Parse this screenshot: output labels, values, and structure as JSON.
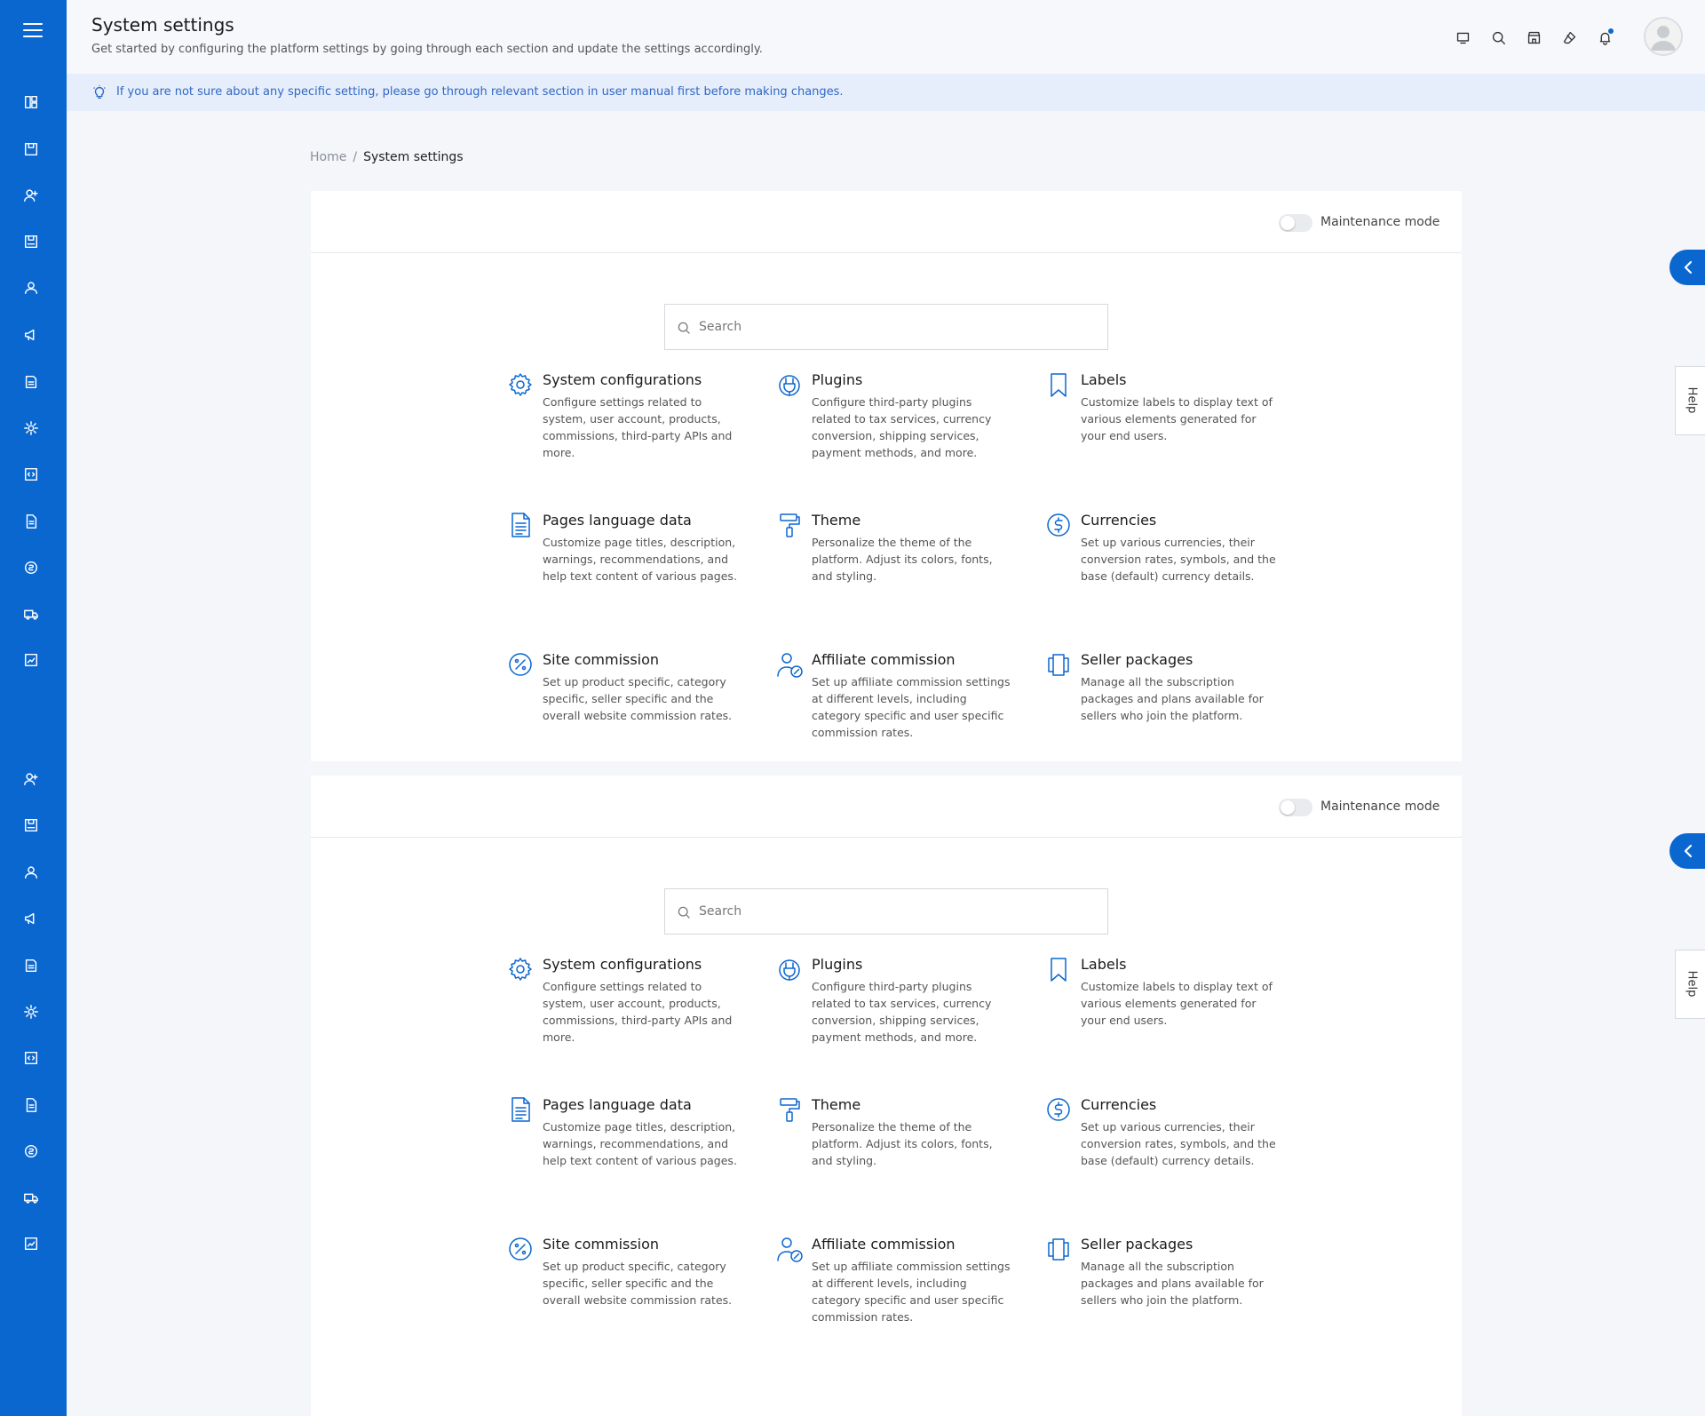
{
  "header": {
    "title": "System settings",
    "subtitle": "Get started by configuring the platform settings by going through each section and update the settings accordingly."
  },
  "info": {
    "text": "If you are not sure about any specific setting, please go through relevant section in user manual first before making changes."
  },
  "breadcrumb": {
    "home": "Home",
    "separator": "/",
    "current": "System settings"
  },
  "panel": {
    "maintenance_label": "Maintenance mode",
    "maintenance_on": false,
    "search_placeholder": "Search"
  },
  "tiles": [
    {
      "icon": "gear-icon",
      "title": "System configurations",
      "desc": "Configure settings related to system, user account, products, commissions, third-party APIs and more."
    },
    {
      "icon": "plug-icon",
      "title": "Plugins",
      "desc": "Configure third-party plugins related to tax services, currency conversion, shipping services, payment methods, and more."
    },
    {
      "icon": "bookmark-icon",
      "title": "Labels",
      "desc": "Customize labels to display text of various elements generated for your end users."
    },
    {
      "icon": "document-icon",
      "title": "Pages language data",
      "desc": "Customize page titles, description, warnings, recommendations, and help text content of various pages."
    },
    {
      "icon": "paint-roller-icon",
      "title": "Theme",
      "desc": "Personalize the theme of the platform. Adjust its colors, fonts, and styling."
    },
    {
      "icon": "dollar-circle-icon",
      "title": "Currencies",
      "desc": "Set up various currencies, their conversion rates, symbols, and the base (default) currency details."
    },
    {
      "icon": "percent-circle-icon",
      "title": "Site commission",
      "desc": "Set up product specific, category specific, seller specific and the overall website commission rates."
    },
    {
      "icon": "user-percent-icon",
      "title": "Affiliate commission",
      "desc": "Set up affiliate commission settings at different levels, including category specific and user specific commission rates."
    },
    {
      "icon": "packages-icon",
      "title": "Seller packages",
      "desc": "Manage all the subscription packages and plans available for sellers who join the platform."
    }
  ],
  "help": {
    "label": "Help"
  },
  "colors": {
    "accent": "#0b67d0",
    "info_text": "#2f68c5",
    "info_bg": "#e7eefb"
  }
}
